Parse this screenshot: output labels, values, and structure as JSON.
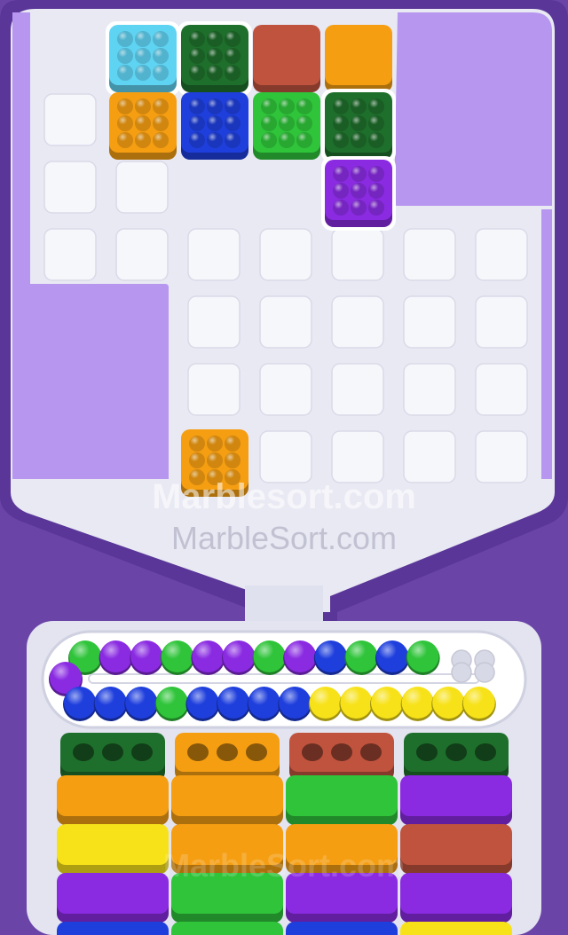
{
  "watermarks": [
    "Marblesort.com",
    "MarbleSort.com",
    "MarbleSort.com"
  ],
  "colors": {
    "background": "#6b44a8",
    "board_frame": "#a37de6",
    "board": "#e8e9f3",
    "slot": "#f6f7fb",
    "lavender": "#b796f0",
    "cyan": "#5fd3f2",
    "dark_green": "#1e6f2c",
    "brick": "#c0533d",
    "orange": "#f59e12",
    "blue": "#1f3fdd",
    "green": "#2fc43a",
    "purple": "#8a2be2",
    "yellow": "#f7e21a"
  },
  "board": {
    "slots": [
      [
        0,
        0
      ],
      [
        0,
        1
      ],
      [
        1,
        0
      ],
      [
        1,
        1
      ],
      [
        1,
        2
      ],
      [
        1,
        3
      ],
      [
        1,
        4
      ],
      [
        1,
        5
      ],
      [
        1,
        6
      ],
      [
        2,
        2
      ],
      [
        2,
        3
      ],
      [
        2,
        4
      ],
      [
        2,
        5
      ],
      [
        2,
        6
      ],
      [
        3,
        2
      ],
      [
        3,
        3
      ],
      [
        3,
        4
      ],
      [
        3,
        5
      ],
      [
        3,
        6
      ],
      [
        4,
        3
      ],
      [
        4,
        4
      ],
      [
        4,
        5
      ],
      [
        4,
        6
      ],
      [
        -1,
        0
      ],
      [
        -1,
        1
      ],
      [
        -1,
        2
      ],
      [
        -1,
        3
      ]
    ],
    "blocks": [
      {
        "row": -2,
        "col": 1,
        "color": "cyan",
        "outlined": true,
        "marbles": true
      },
      {
        "row": -2,
        "col": 2,
        "color": "dark_green",
        "outlined": true,
        "marbles": true
      },
      {
        "row": -2,
        "col": 3,
        "color": "brick",
        "outlined": false,
        "marbles": false
      },
      {
        "row": -2,
        "col": 4,
        "color": "orange",
        "outlined": false,
        "marbles": false
      },
      {
        "row": -1,
        "col": 1,
        "color": "orange",
        "outlined": false,
        "marbles": true
      },
      {
        "row": -1,
        "col": 2,
        "color": "blue",
        "outlined": false,
        "marbles": true
      },
      {
        "row": -1,
        "col": 3,
        "color": "green",
        "outlined": false,
        "marbles": true
      },
      {
        "row": -1,
        "col": 4,
        "color": "dark_green",
        "outlined": true,
        "marbles": true
      },
      {
        "row": 0,
        "col": 4,
        "color": "purple",
        "outlined": true,
        "marbles": true
      },
      {
        "row": 4,
        "col": 2,
        "color": "orange",
        "outlined": false,
        "marbles": true
      }
    ]
  },
  "conveyor": {
    "top_row": [
      "green",
      "purple",
      "purple",
      "green",
      "purple",
      "purple",
      "green",
      "purple",
      "blue",
      "green",
      "blue",
      "green"
    ],
    "left_end": [
      "purple"
    ],
    "bottom_row": [
      "blue",
      "blue",
      "blue",
      "green",
      "blue",
      "blue",
      "blue",
      "blue",
      "yellow",
      "yellow",
      "yellow",
      "yellow",
      "yellow",
      "yellow"
    ],
    "empty_slots": 4
  },
  "bins": [
    {
      "cup": "dark_green",
      "stack": [
        "orange",
        "yellow",
        "purple",
        "blue"
      ]
    },
    {
      "cup": "orange",
      "stack": [
        "orange",
        "orange",
        "green",
        "green"
      ]
    },
    {
      "cup": "brick",
      "stack": [
        "green",
        "orange",
        "purple",
        "blue"
      ]
    },
    {
      "cup": "dark_green",
      "stack": [
        "purple",
        "brick",
        "purple",
        "yellow"
      ]
    }
  ]
}
